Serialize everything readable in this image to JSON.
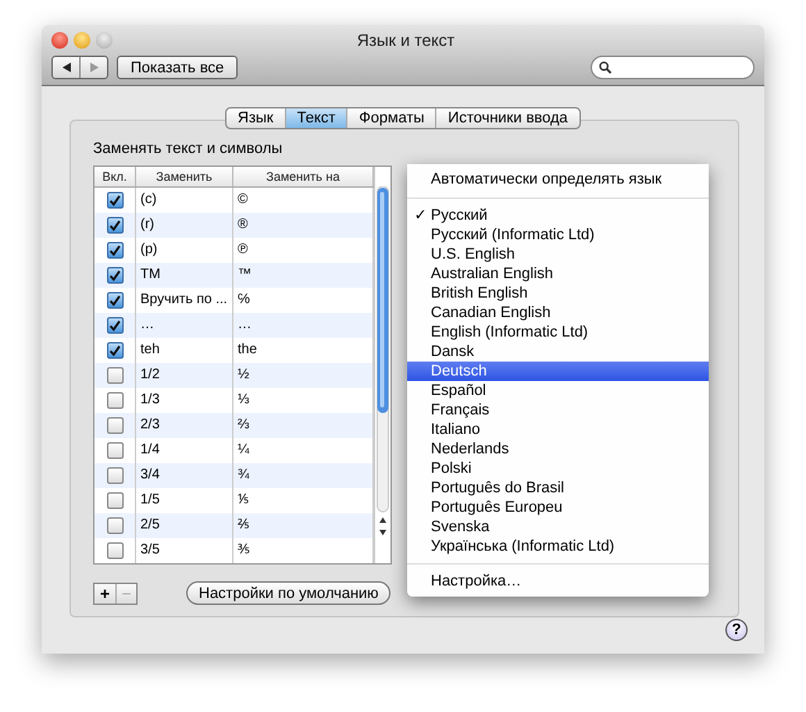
{
  "window": {
    "title": "Язык и текст"
  },
  "toolbar": {
    "show_all": "Показать все"
  },
  "tabs": [
    {
      "label": "Язык",
      "selected": false
    },
    {
      "label": "Текст",
      "selected": true
    },
    {
      "label": "Форматы",
      "selected": false
    },
    {
      "label": "Источники ввода",
      "selected": false
    }
  ],
  "section_title": "Заменять текст и символы",
  "table": {
    "columns": [
      "Вкл.",
      "Заменить",
      "Заменить на"
    ],
    "rows": [
      {
        "on": true,
        "replace": "(c)",
        "with": "©"
      },
      {
        "on": true,
        "replace": "(r)",
        "with": "®"
      },
      {
        "on": true,
        "replace": "(p)",
        "with": "℗"
      },
      {
        "on": true,
        "replace": "TM",
        "with": "™"
      },
      {
        "on": true,
        "replace": "Вручить по ...",
        "with": "℅"
      },
      {
        "on": true,
        "replace": "…",
        "with": "…"
      },
      {
        "on": true,
        "replace": "teh",
        "with": "the"
      },
      {
        "on": false,
        "replace": "1/2",
        "with": "½"
      },
      {
        "on": false,
        "replace": "1/3",
        "with": "⅓"
      },
      {
        "on": false,
        "replace": "2/3",
        "with": "⅔"
      },
      {
        "on": false,
        "replace": "1/4",
        "with": "¼"
      },
      {
        "on": false,
        "replace": "3/4",
        "with": "¾"
      },
      {
        "on": false,
        "replace": "1/5",
        "with": "⅕"
      },
      {
        "on": false,
        "replace": "2/5",
        "with": "⅖"
      },
      {
        "on": false,
        "replace": "3/5",
        "with": "⅗"
      }
    ]
  },
  "table_buttons": [
    {
      "label": "+",
      "disabled": false
    },
    {
      "label": "−",
      "disabled": true
    }
  ],
  "restore_defaults": "Настройки по умолчанию",
  "help": "?",
  "language_menu": {
    "header": "Автоматически определять язык",
    "items": [
      {
        "label": "Русский",
        "checked": true,
        "selected": false
      },
      {
        "label": "Русский (Informatic Ltd)",
        "checked": false,
        "selected": false
      },
      {
        "label": "U.S. English",
        "checked": false,
        "selected": false
      },
      {
        "label": "Australian English",
        "checked": false,
        "selected": false
      },
      {
        "label": "British English",
        "checked": false,
        "selected": false
      },
      {
        "label": "Canadian English",
        "checked": false,
        "selected": false
      },
      {
        "label": "English (Informatic Ltd)",
        "checked": false,
        "selected": false
      },
      {
        "label": "Dansk",
        "checked": false,
        "selected": false
      },
      {
        "label": "Deutsch",
        "checked": false,
        "selected": true
      },
      {
        "label": "Español",
        "checked": false,
        "selected": false
      },
      {
        "label": "Français",
        "checked": false,
        "selected": false
      },
      {
        "label": "Italiano",
        "checked": false,
        "selected": false
      },
      {
        "label": "Nederlands",
        "checked": false,
        "selected": false
      },
      {
        "label": "Polski",
        "checked": false,
        "selected": false
      },
      {
        "label": "Português do Brasil",
        "checked": false,
        "selected": false
      },
      {
        "label": "Português Europeu",
        "checked": false,
        "selected": false
      },
      {
        "label": "Svenska",
        "checked": false,
        "selected": false
      },
      {
        "label": "Українська (Informatic Ltd)",
        "checked": false,
        "selected": false
      }
    ],
    "check_mark": "✓",
    "footer": "Настройка…"
  }
}
